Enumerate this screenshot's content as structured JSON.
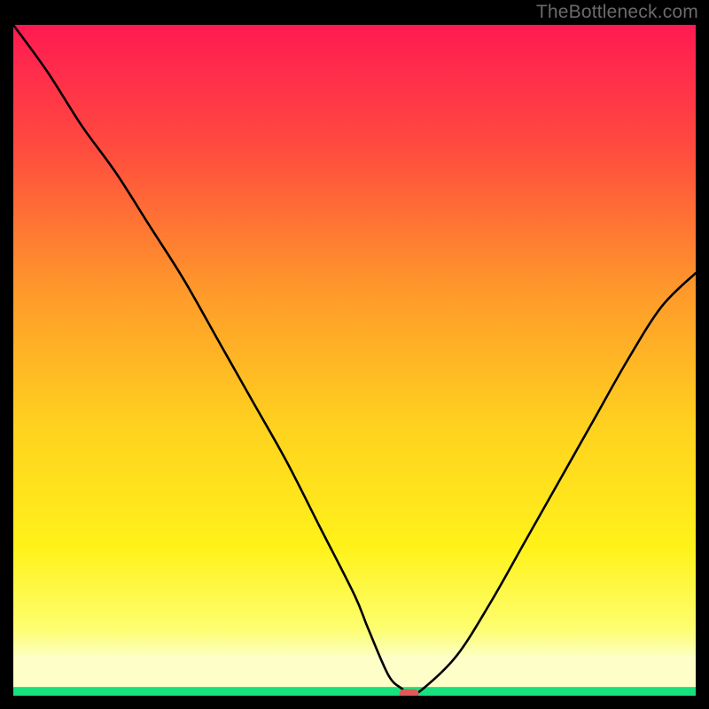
{
  "watermark": "TheBottleneck.com",
  "chart_data": {
    "type": "line",
    "title": "",
    "xlabel": "",
    "ylabel": "",
    "xlim": [
      0,
      100
    ],
    "ylim": [
      0,
      100
    ],
    "grid": false,
    "legend": false,
    "series": [
      {
        "name": "bottleneck-curve",
        "x": [
          0,
          5,
          10,
          15,
          20,
          25,
          30,
          35,
          40,
          45,
          50,
          52,
          55,
          57,
          58,
          60,
          65,
          70,
          75,
          80,
          85,
          90,
          95,
          100
        ],
        "y": [
          100,
          93,
          85,
          78,
          70,
          62,
          53,
          44,
          35,
          25,
          15,
          10,
          3,
          1,
          0,
          1,
          6,
          14,
          23,
          32,
          41,
          50,
          58,
          63
        ]
      },
      {
        "name": "green-band",
        "type": "area",
        "x": [
          0,
          100
        ],
        "y": [
          1.3,
          1.3
        ]
      },
      {
        "name": "yellow-band",
        "type": "area",
        "x": [
          0,
          100
        ],
        "y": [
          6,
          6
        ]
      }
    ],
    "annotations": [
      {
        "name": "optimal-marker",
        "x": 58,
        "y": 0.3,
        "color": "#e05858"
      }
    ],
    "background_gradient": {
      "stops": [
        {
          "offset": 0.0,
          "color": "#ff1a52"
        },
        {
          "offset": 0.18,
          "color": "#ff4a3f"
        },
        {
          "offset": 0.4,
          "color": "#ff9a2a"
        },
        {
          "offset": 0.6,
          "color": "#ffd21f"
        },
        {
          "offset": 0.78,
          "color": "#fff21a"
        },
        {
          "offset": 0.9,
          "color": "#fdfe70"
        },
        {
          "offset": 0.94,
          "color": "#fbffbd"
        },
        {
          "offset": 0.97,
          "color": "#c9ffb0"
        },
        {
          "offset": 0.985,
          "color": "#7cf5a0"
        },
        {
          "offset": 1.0,
          "color": "#18e27e"
        }
      ]
    }
  }
}
